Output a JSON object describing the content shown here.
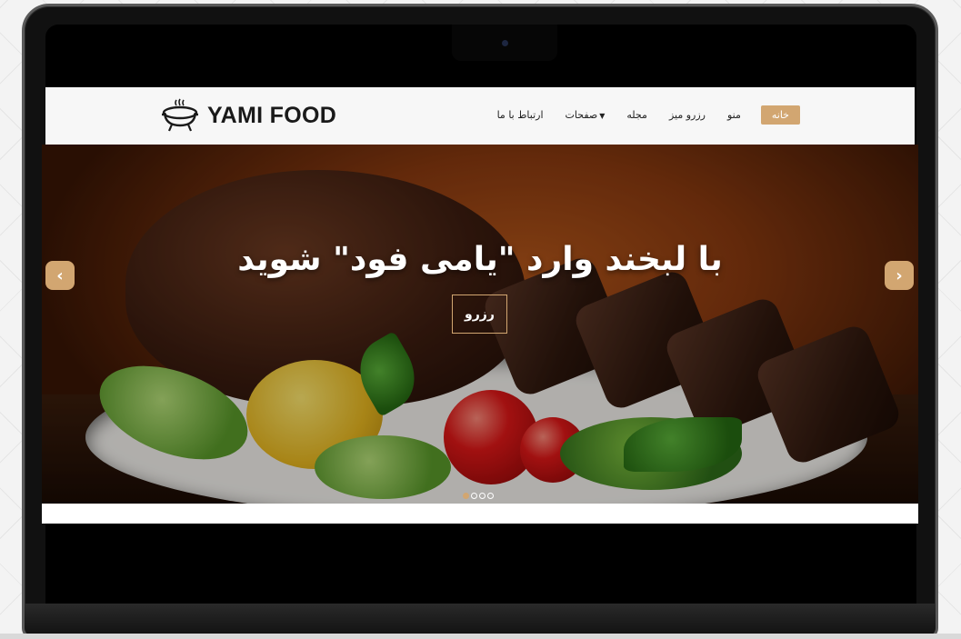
{
  "brand": {
    "name": "YAMI FOOD",
    "logo_icon": "grill-icon"
  },
  "nav": {
    "items": [
      {
        "label": "خانه",
        "active": true
      },
      {
        "label": "منو"
      },
      {
        "label": "رزرو میز"
      },
      {
        "label": "مجله"
      },
      {
        "label": "صفحات",
        "dropdown": true
      },
      {
        "label": "ارتباط با ما"
      }
    ],
    "accent_color": "#d2a671"
  },
  "hero": {
    "title": "با لبخند وارد \"یامی فود\" شوید",
    "button_label": "رزرو",
    "prev_icon": "chevron-left-icon",
    "next_icon": "chevron-right-icon",
    "slides_count": 4,
    "active_slide": 1
  }
}
